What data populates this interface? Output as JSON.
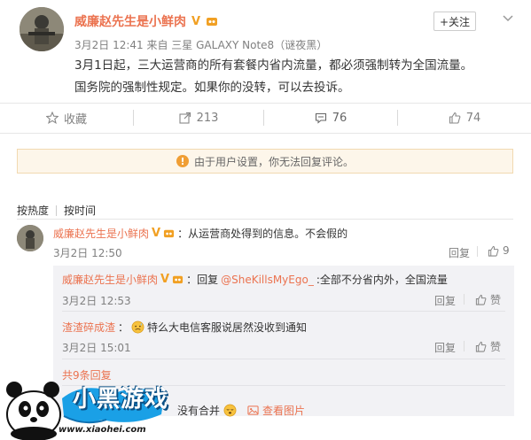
{
  "post": {
    "author": "威廉赵先生是小鲜肉",
    "vip_badge": "V",
    "meta": "3月2日 12:41 来自 三星 GALAXY Note8（谜夜黑）",
    "follow_label": "+关注",
    "text_line1": "3月1日起，三大运营商的所有套餐内省内流量，都必须强制转为全国流量。",
    "text_line2": "国务院的强制性规定。如果你的没转，可以去投诉。"
  },
  "actions": {
    "collect": "收藏",
    "repost": "213",
    "comment": "76",
    "like": "74"
  },
  "notice": "由于用户设置，你无法回复评论。",
  "sort": {
    "by_hot": "按热度",
    "by_time": "按时间"
  },
  "comments": [
    {
      "author": "威廉赵先生是小鲜肉",
      "text": "：从运营商处得到的信息。不会假的",
      "time": "3月2日 12:50",
      "reply": "回复",
      "likes": "9"
    }
  ],
  "replies": [
    {
      "author": "威廉赵先生是小鲜肉",
      "text_prefix": "：回复",
      "mention": "@SheKillsMyEgo_",
      "text_suffix": ":全部不分省内外，全国流量",
      "time": "3月2日 12:53",
      "reply": "回复",
      "like": "赞"
    },
    {
      "author": "渣渣碎成渣",
      "text": "特么大电信客服说居然没收到通知",
      "time": "3月2日 15:01",
      "reply": "回复",
      "like": "赞"
    }
  ],
  "more_replies": "共9条回复",
  "bottom": {
    "partial_text": "没有合并",
    "view_image": "查看图片"
  },
  "watermark": {
    "brand": "小黑游戏",
    "url": "www.xiaohei.com"
  },
  "colors": {
    "name": "#eb7350",
    "badge": "#f1a023",
    "notice_bg": "#fdf6ea"
  }
}
